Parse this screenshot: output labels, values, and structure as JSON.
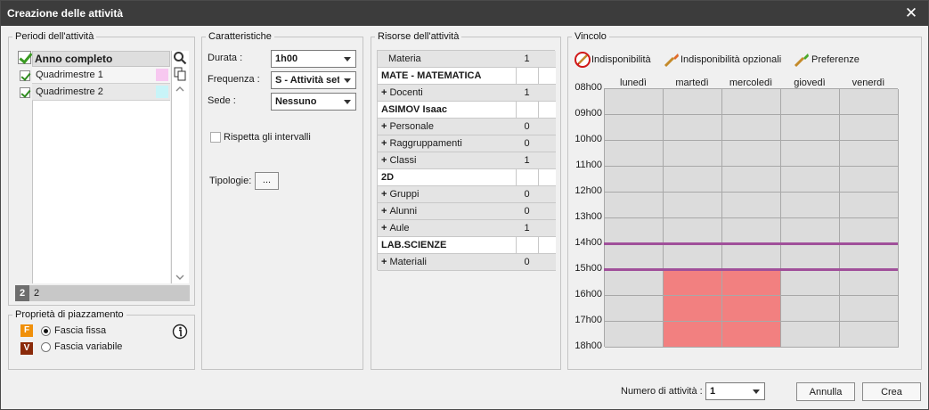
{
  "window": {
    "title": "Creazione delle attività"
  },
  "periods": {
    "legend": "Periodi dell'attività",
    "header": "Anno completo",
    "items": [
      {
        "label": "Quadrimestre 1",
        "color": "#f7c8f0"
      },
      {
        "label": "Quadrimestre 2",
        "color": "#c8f4f8"
      }
    ],
    "footer_badge": "2",
    "footer_value": "2"
  },
  "placement": {
    "legend": "Proprietà di piazzamento",
    "fixed_badge": "F",
    "fixed_label": "Fascia fissa",
    "variable_badge": "V",
    "variable_label": "Fascia variabile",
    "fixed_color": "#f0900a",
    "variable_color": "#8a2a0a"
  },
  "characteristics": {
    "legend": "Caratteristiche",
    "durata_label": "Durata :",
    "durata_value": "1h00",
    "frequenza_label": "Frequenza :",
    "frequenza_value": "S - Attività settimanale",
    "sede_label": "Sede :",
    "sede_value": "Nessuno",
    "rispetta_label": "Rispetta gli intervalli",
    "tipologie_label": "Tipologie:",
    "tipologie_button": "..."
  },
  "resources": {
    "legend": "Risorse dell'attività",
    "rows": [
      {
        "kind": "grey-head",
        "label": "Materia",
        "count": "1"
      },
      {
        "kind": "white",
        "label": "MATE - MATEMATICA"
      },
      {
        "kind": "grey",
        "label": "Docenti",
        "count": "1"
      },
      {
        "kind": "white",
        "label": "ASIMOV Isaac"
      },
      {
        "kind": "grey",
        "label": "Personale",
        "count": "0"
      },
      {
        "kind": "grey",
        "label": "Raggruppamenti",
        "count": "0"
      },
      {
        "kind": "grey",
        "label": "Classi",
        "count": "1"
      },
      {
        "kind": "white",
        "label": "2D"
      },
      {
        "kind": "grey",
        "label": "Gruppi",
        "count": "0"
      },
      {
        "kind": "grey",
        "label": "Alunni",
        "count": "0"
      },
      {
        "kind": "grey",
        "label": "Aule",
        "count": "1"
      },
      {
        "kind": "white",
        "label": "LAB.SCIENZE"
      },
      {
        "kind": "grey",
        "label": "Materiali",
        "count": "0"
      }
    ]
  },
  "constraint": {
    "legend": "Vincolo",
    "tools": {
      "unavailability": "Indisponibilità",
      "optional_unavailability": "Indisponibilità opzionali",
      "preferences": "Preferenze"
    },
    "days": [
      "lunedì",
      "martedì",
      "mercoledì",
      "giovedì",
      "venerdì"
    ],
    "hours": [
      "08h00",
      "09h00",
      "10h00",
      "11h00",
      "12h00",
      "13h00",
      "14h00",
      "15h00",
      "16h00",
      "17h00",
      "18h00"
    ],
    "unavailable": [
      {
        "day": 1,
        "from_hour": 7,
        "to_hour": 10
      },
      {
        "day": 2,
        "from_hour": 7,
        "to_hour": 10
      }
    ],
    "marked_hours": [
      6,
      7
    ],
    "cell_color": "#dcdcdc",
    "unavailable_color": "#f28080",
    "marker_color": "#a0509a"
  },
  "footer": {
    "count_label": "Numero di attività :",
    "count_value": "1",
    "cancel_label": "Annulla",
    "create_label": "Crea"
  }
}
